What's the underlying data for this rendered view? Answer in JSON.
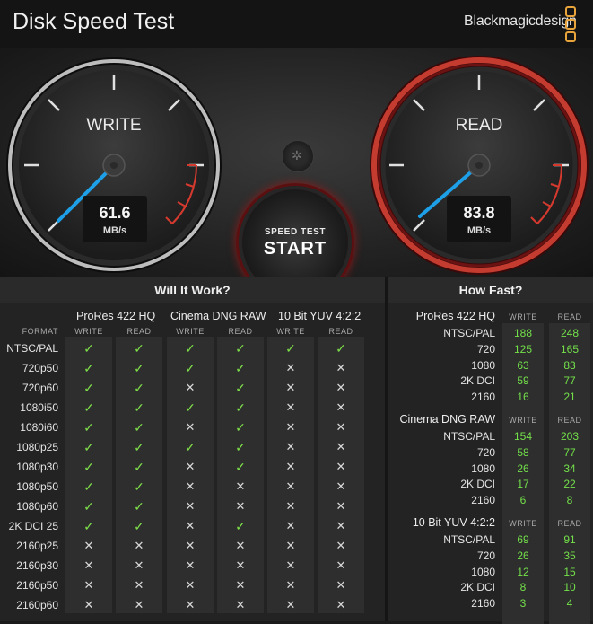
{
  "app": {
    "title": "Disk Speed Test",
    "brand": "Blackmagicdesign",
    "brand_color": "#e8a33a"
  },
  "write_gauge": {
    "label": "WRITE",
    "value": "61.6",
    "unit": "MB/s"
  },
  "read_gauge": {
    "label": "READ",
    "value": "83.8",
    "unit": "MB/s"
  },
  "start_button": {
    "small_label": "SPEED TEST",
    "big_label": "START",
    "ring_color": "#8c1a1a"
  },
  "settings_button": {
    "icon": "gear-icon"
  },
  "will_it_work": {
    "title": "Will It Work?",
    "format_header": "FORMAT",
    "write_header": "WRITE",
    "read_header": "READ",
    "codecs": [
      "ProRes 422 HQ",
      "Cinema DNG RAW",
      "10 Bit YUV 4:2:2"
    ],
    "rows": [
      {
        "format": "NTSC/PAL",
        "values": [
          true,
          true,
          true,
          true,
          true,
          true
        ]
      },
      {
        "format": "720p50",
        "values": [
          true,
          true,
          true,
          true,
          false,
          false
        ]
      },
      {
        "format": "720p60",
        "values": [
          true,
          true,
          false,
          true,
          false,
          false
        ]
      },
      {
        "format": "1080i50",
        "values": [
          true,
          true,
          true,
          true,
          false,
          false
        ]
      },
      {
        "format": "1080i60",
        "values": [
          true,
          true,
          false,
          true,
          false,
          false
        ]
      },
      {
        "format": "1080p25",
        "values": [
          true,
          true,
          true,
          true,
          false,
          false
        ]
      },
      {
        "format": "1080p30",
        "values": [
          true,
          true,
          false,
          true,
          false,
          false
        ]
      },
      {
        "format": "1080p50",
        "values": [
          true,
          true,
          false,
          false,
          false,
          false
        ]
      },
      {
        "format": "1080p60",
        "values": [
          true,
          true,
          false,
          false,
          false,
          false
        ]
      },
      {
        "format": "2K DCI 25",
        "values": [
          true,
          true,
          false,
          true,
          false,
          false
        ]
      },
      {
        "format": "2160p25",
        "values": [
          false,
          false,
          false,
          false,
          false,
          false
        ]
      },
      {
        "format": "2160p30",
        "values": [
          false,
          false,
          false,
          false,
          false,
          false
        ]
      },
      {
        "format": "2160p50",
        "values": [
          false,
          false,
          false,
          false,
          false,
          false
        ]
      },
      {
        "format": "2160p60",
        "values": [
          false,
          false,
          false,
          false,
          false,
          false
        ]
      }
    ],
    "check_glyph": "✓",
    "cross_glyph": "✕",
    "check_color": "#7ee04a"
  },
  "how_fast": {
    "title": "How Fast?",
    "write_header": "WRITE",
    "read_header": "READ",
    "groups": [
      {
        "codec": "ProRes 422 HQ",
        "rows": [
          {
            "format": "NTSC/PAL",
            "write": "188",
            "read": "248"
          },
          {
            "format": "720",
            "write": "125",
            "read": "165"
          },
          {
            "format": "1080",
            "write": "63",
            "read": "83"
          },
          {
            "format": "2K DCI",
            "write": "59",
            "read": "77"
          },
          {
            "format": "2160",
            "write": "16",
            "read": "21"
          }
        ]
      },
      {
        "codec": "Cinema DNG RAW",
        "rows": [
          {
            "format": "NTSC/PAL",
            "write": "154",
            "read": "203"
          },
          {
            "format": "720",
            "write": "58",
            "read": "77"
          },
          {
            "format": "1080",
            "write": "26",
            "read": "34"
          },
          {
            "format": "2K DCI",
            "write": "17",
            "read": "22"
          },
          {
            "format": "2160",
            "write": "6",
            "read": "8"
          }
        ]
      },
      {
        "codec": "10 Bit YUV 4:2:2",
        "rows": [
          {
            "format": "NTSC/PAL",
            "write": "69",
            "read": "91"
          },
          {
            "format": "720",
            "write": "26",
            "read": "35"
          },
          {
            "format": "1080",
            "write": "12",
            "read": "15"
          },
          {
            "format": "2K DCI",
            "write": "8",
            "read": "10"
          },
          {
            "format": "2160",
            "write": "3",
            "read": "4"
          }
        ]
      }
    ],
    "number_color": "#73e04a"
  }
}
